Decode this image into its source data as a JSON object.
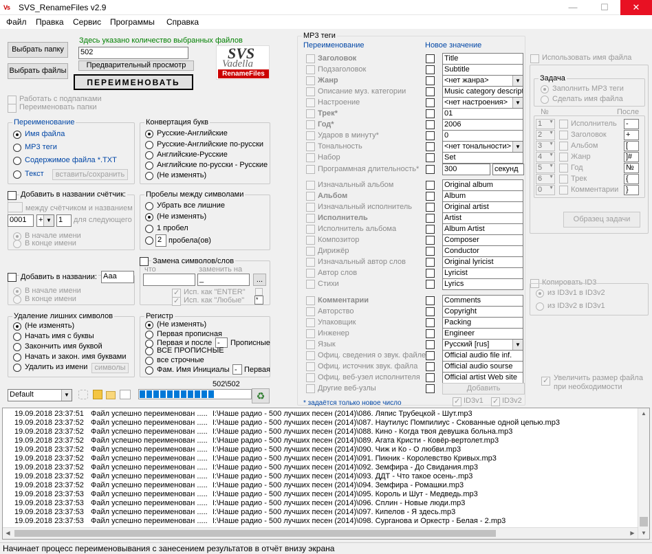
{
  "window": {
    "title": "SVS_RenameFiles v2.9",
    "minimize": "—",
    "maximize": "☐",
    "close": "✕"
  },
  "menu": [
    "Файл",
    "Правка",
    "Сервис",
    "Программы",
    "Справка"
  ],
  "left": {
    "choose_folder": "Выбрать папку",
    "choose_files": "Выбрать файлы",
    "count_caption": "Здесь указано количество выбранных файлов",
    "count_value": "502",
    "preview": "Предварительный просмотр",
    "rename": "ПЕРЕИМЕНОВАТЬ",
    "subfolders": "Работать с подпапками",
    "rename_folders": "Переименовать папки",
    "logo": {
      "top": "SVS",
      "mid": "Vadella",
      "bot": "RenameFiles"
    }
  },
  "rename_group": {
    "title": "Переименование",
    "options": [
      "Имя файла",
      "MP3 теги",
      "Содержимое файла *.TXT",
      "Текст"
    ],
    "insert_save": "вставить/сохранить"
  },
  "convert_group": {
    "title": "Конвертация букв",
    "options": [
      "Русские-Английские",
      "Русские-Английские по-русски",
      "Английские-Русские",
      "Английские по-русски - Русские",
      "(Не изменять)"
    ]
  },
  "counter": {
    "label": "Добавить в названии счётчик:",
    "between": "между счётчиком и названием",
    "start": "0001",
    "op": "+",
    "step": "1",
    "for_next": "для следующего",
    "pos1": "В начале имени",
    "pos2": "В конце имени"
  },
  "spaces_group": {
    "title": "Пробелы между символами",
    "options": [
      "Убрать все лишние",
      "(Не изменять)",
      "1 пробел",
      "пробела(ов)"
    ],
    "count": "2"
  },
  "add_name": {
    "label": "Добавить в названии:",
    "value": "Ааа",
    "pos1": "В начале имени",
    "pos2": "В конце имени"
  },
  "replace": {
    "label": "Замена символов/слов",
    "what": "что",
    "with": "заменить на",
    "with_value": "_",
    "dots": "...",
    "enter": "Исп. как \"ENTER\"",
    "any": "Исп. как \"Любые\"",
    "any_val": "*"
  },
  "remove_group": {
    "title": "Удаление лишних символов",
    "options": [
      "(Не изменять)",
      "Начать имя с буквы",
      "Закончить имя буквой",
      "Начать и закон. имя буквами",
      "Удалить из имени"
    ],
    "symbols": "символы"
  },
  "case_group": {
    "title": "Регистр",
    "options": [
      "(Не изменять)",
      "Первая прописная",
      "Первая и после",
      "ВСЕ ПРОПИСНЫЕ",
      "все строчные",
      "Фам. Имя Инициалы"
    ],
    "after_char": "-",
    "after_tail": "Прописные",
    "init_char": "-",
    "init_tail": "Первая"
  },
  "bottom_bar": {
    "preset": "Default",
    "progress_text": "502\\502",
    "progress": 1.0
  },
  "mp3": {
    "title": "MP3 теги",
    "col_rename": "Переименование",
    "col_new": "Новое значение",
    "use_filename": "Использовать имя файла",
    "rows": [
      {
        "label": "Заголовок",
        "value": "Title",
        "bold": true
      },
      {
        "label": "Подзаголовок",
        "value": "Subtitle"
      },
      {
        "label": "Жанр",
        "value": "<нет жанра>",
        "bold": true,
        "select": true
      },
      {
        "label": "Описание муз. категории",
        "value": "Music category descripti"
      },
      {
        "label": "Настроение",
        "value": "<нет настроения>",
        "select": true
      },
      {
        "label": "Трек*",
        "value": "01",
        "bold": true
      },
      {
        "label": "Год*",
        "value": "2006",
        "bold": true
      },
      {
        "label": "Ударов в минуту*",
        "value": "0"
      },
      {
        "label": "Тональность",
        "value": "<нет тональности>",
        "select": true
      },
      {
        "label": "Набор",
        "value": "Set"
      },
      {
        "label": "Программная длительность*",
        "value": "300",
        "unit": "секунд"
      },
      {
        "label": "Изначальный альбом",
        "value": "Original album"
      },
      {
        "label": "Альбом",
        "value": "Album",
        "bold": true
      },
      {
        "label": "Изначальный исполнитель",
        "value": "Original artist"
      },
      {
        "label": "Исполнитель",
        "value": "Artist",
        "bold": true
      },
      {
        "label": "Исполнитель альбома",
        "value": "Album Artist"
      },
      {
        "label": "Композитор",
        "value": "Composer"
      },
      {
        "label": "Дирижёр",
        "value": "Conductor"
      },
      {
        "label": "Изначальный автор слов",
        "value": "Original lyricist"
      },
      {
        "label": "Автор слов",
        "value": "Lyricist"
      },
      {
        "label": "Стихи",
        "value": "Lyrics"
      },
      {
        "label": "Комментарии",
        "value": "Comments",
        "bold": true
      },
      {
        "label": "Авторство",
        "value": "Copyright"
      },
      {
        "label": "Упаковщик",
        "value": "Packing"
      },
      {
        "label": "Инженер",
        "value": "Engineer"
      },
      {
        "label": "Язык",
        "value": "Русский [rus]",
        "select": true
      },
      {
        "label": "Офиц. сведения о звук. файле",
        "value": "Official audio file inf."
      },
      {
        "label": "Офиц. источник звук. файла",
        "value": "Official audio sourse"
      },
      {
        "label": "Офиц. веб-узел исполнителя",
        "value": "Official artist Web site"
      },
      {
        "label": "Другие веб-узлы",
        "value": "Добавить",
        "button": true
      }
    ],
    "footnote": "* задаётся только новое число",
    "id3v1": "ID3v1",
    "id3v2": "ID3v2",
    "task": {
      "title": "Задача",
      "opt1": "Заполнить MP3 теги",
      "opt2": "Сделать имя файла",
      "num": "№",
      "after": "После",
      "items": [
        {
          "n": "1",
          "label": "Исполнитель",
          "after": "-"
        },
        {
          "n": "2",
          "label": "Заголовок",
          "after": "+"
        },
        {
          "n": "3",
          "label": "Альбом",
          "after": "["
        },
        {
          "n": "4",
          "label": "Жанр",
          "after": "]#"
        },
        {
          "n": "5",
          "label": "Год",
          "after": "№"
        },
        {
          "n": "6",
          "label": "Трек",
          "after": "{"
        },
        {
          "n": "0",
          "label": "Комментарии",
          "after": "}"
        }
      ],
      "sample": "Образец задачи"
    },
    "copy": {
      "label": "Копировать ID3",
      "opt1": "из ID3v1 в ID3v2",
      "opt2": "из ID3v2 в ID3v1"
    },
    "enlarge": "Увеличить размер файла при необходимости"
  },
  "log": [
    {
      "time": "19.09.2018 23:37:51",
      "msg": "Файл успешно переименован .....",
      "path": "I:\\Наше радио - 500 лучших песен (2014)\\086. Ляпис Трубецкой - Шут.mp3"
    },
    {
      "time": "19.09.2018 23:37:52",
      "msg": "Файл успешно переименован .....",
      "path": "I:\\Наше радио - 500 лучших песен (2014)\\087. Наутилус Помпилиус - Скованные одной цепью.mp3"
    },
    {
      "time": "19.09.2018 23:37:52",
      "msg": "Файл успешно переименован .....",
      "path": "I:\\Наше радио - 500 лучших песен (2014)\\088. Кино - Когда твоя девушка больна.mp3"
    },
    {
      "time": "19.09.2018 23:37:52",
      "msg": "Файл успешно переименован .....",
      "path": "I:\\Наше радио - 500 лучших песен (2014)\\089. Агата Кристи - Ковёр-вертолет.mp3"
    },
    {
      "time": "19.09.2018 23:37:52",
      "msg": "Файл успешно переименован .....",
      "path": "I:\\Наше радио - 500 лучших песен (2014)\\090. Чиж и Ко - О любви.mp3"
    },
    {
      "time": "19.09.2018 23:37:52",
      "msg": "Файл успешно переименован .....",
      "path": "I:\\Наше радио - 500 лучших песен (2014)\\091. Пикник - Королевство Кривых.mp3"
    },
    {
      "time": "19.09.2018 23:37:52",
      "msg": "Файл успешно переименован .....",
      "path": "I:\\Наше радио - 500 лучших песен (2014)\\092. Земфира - До Свидания.mp3"
    },
    {
      "time": "19.09.2018 23:37:52",
      "msg": "Файл успешно переименован .....",
      "path": "I:\\Наше радио - 500 лучших песен (2014)\\093. ДДТ - Что такое осень-.mp3"
    },
    {
      "time": "19.09.2018 23:37:52",
      "msg": "Файл успешно переименован .....",
      "path": "I:\\Наше радио - 500 лучших песен (2014)\\094. Земфира - Ромашки.mp3"
    },
    {
      "time": "19.09.2018 23:37:53",
      "msg": "Файл успешно переименован .....",
      "path": "I:\\Наше радио - 500 лучших песен (2014)\\095. Король и Шут - Медведь.mp3"
    },
    {
      "time": "19.09.2018 23:37:53",
      "msg": "Файл успешно переименован .....",
      "path": "I:\\Наше радио - 500 лучших песен (2014)\\096. Сплин - Новые люди.mp3"
    },
    {
      "time": "19.09.2018 23:37:53",
      "msg": "Файл успешно переименован .....",
      "path": "I:\\Наше радио - 500 лучших песен (2014)\\097. Кипелов - Я здесь.mp3"
    },
    {
      "time": "19.09.2018 23:37:53",
      "msg": "Файл успешно переименован .....",
      "path": "I:\\Наше радио - 500 лучших песен (2014)\\098. Сурганова и Оркестр - Белая - 2.mp3"
    }
  ],
  "status": "Начинает процесс переименовывания с занесением результатов в отчёт внизу экрана",
  "colors": {
    "accent": "#0046a6",
    "caption": "#008000",
    "progress": "#0078d7",
    "close": "#e81123"
  }
}
